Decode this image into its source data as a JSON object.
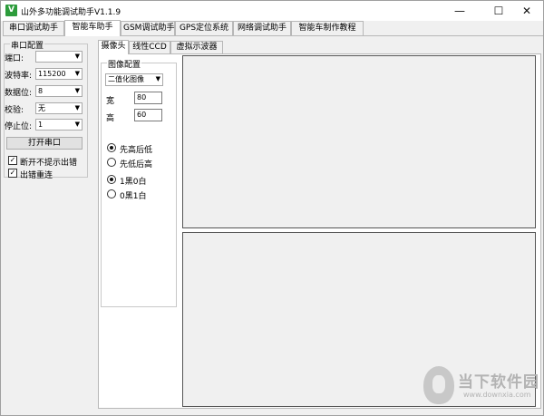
{
  "window": {
    "title": "山外多功能调试助手V1.1.9",
    "icon_letter": "V",
    "minimize": "—",
    "maximize": "☐",
    "close": "✕"
  },
  "main_tabs": [
    "串口调试助手",
    "智能车助手",
    "GSM调试助手",
    "GPS定位系统",
    "网络调试助手",
    "智能车制作教程"
  ],
  "active_main_tab": "智能车助手",
  "serial": {
    "group_title": "串口配置",
    "port_label": "端口:",
    "port_value": "",
    "baud_label": "波特率:",
    "baud_value": "115200",
    "databits_label": "数据位:",
    "databits_value": "8",
    "parity_label": "校验:",
    "parity_value": "无",
    "stopbits_label": "停止位:",
    "stopbits_value": "1",
    "open_button": "打开串口",
    "no_error_prompt_label": "断开不提示出错",
    "no_error_prompt_checked": true,
    "reconnect_label": "出错重连",
    "reconnect_checked": true
  },
  "sub_tabs": [
    "摄像头",
    "线性CCD",
    "虚拟示波器"
  ],
  "active_sub_tab": "摄像头",
  "image_config": {
    "group_title": "图像配置",
    "mode_value": "二值化图像",
    "width_label": "宽",
    "width_value": "80",
    "height_label": "高",
    "height_value": "60",
    "order_high_first": "先高后低",
    "order_low_first": "先低后高",
    "order_selected": "先高后低",
    "color_1black": "1黑0白",
    "color_0black": "0黑1白",
    "color_selected": "1黑0白"
  },
  "watermark": {
    "text": "当下软件园",
    "url": "www.downxia.com"
  },
  "colors": {
    "window_bg": "#f0f0f0",
    "icon_green": "#2d9c3c",
    "display_border": "#555555"
  }
}
